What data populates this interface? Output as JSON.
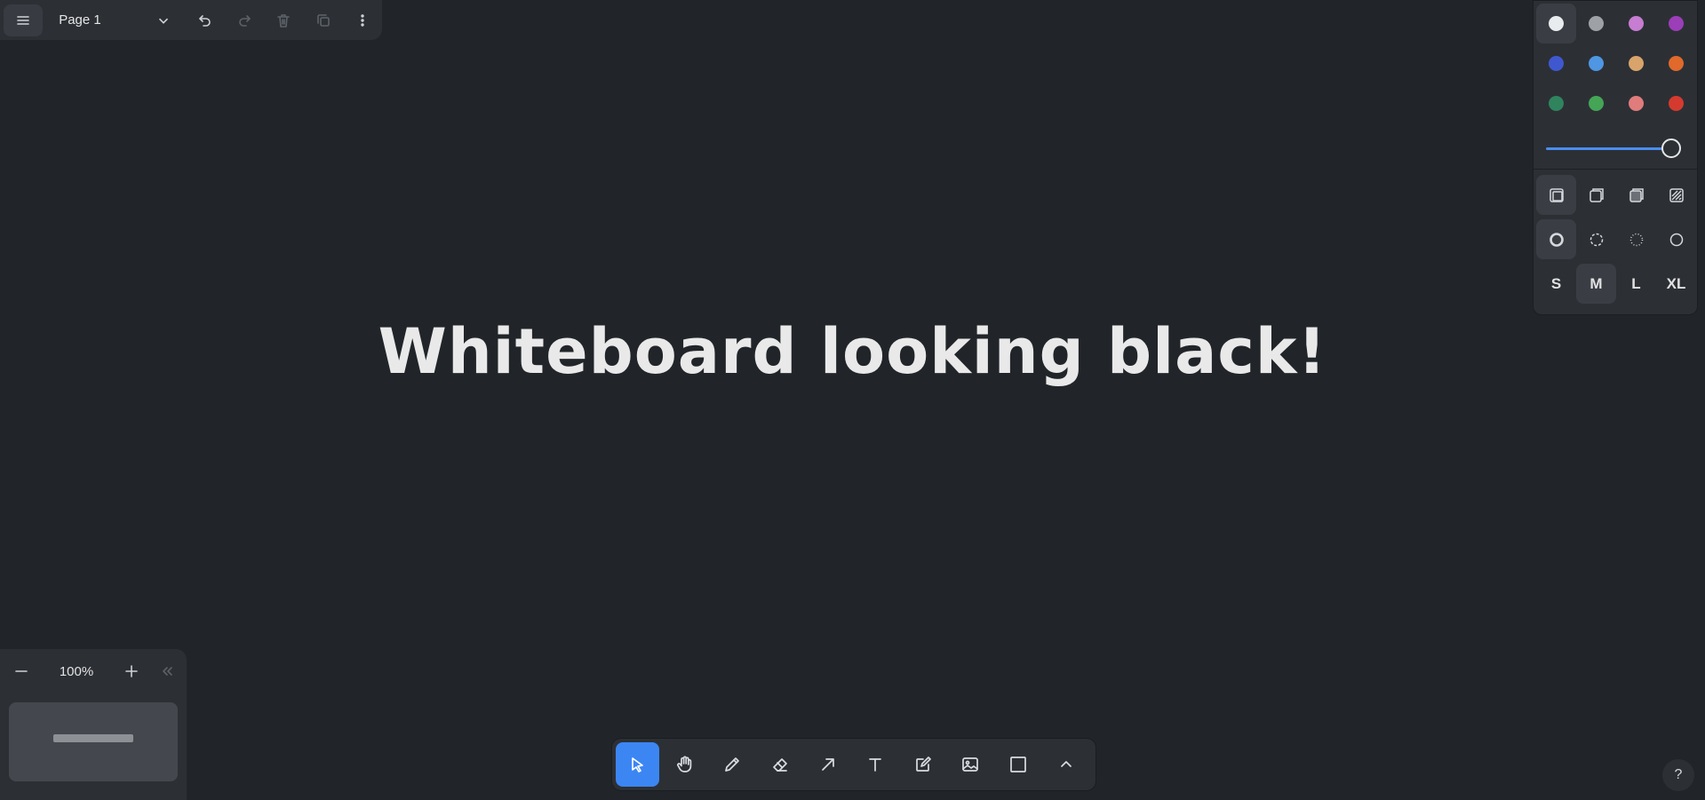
{
  "menu": {
    "page_name": "Page 1",
    "icons": [
      "hamburger-icon",
      "chevron-down-icon",
      "undo-icon",
      "redo-icon",
      "trash-icon",
      "duplicate-icon",
      "more-vertical-icon"
    ]
  },
  "canvas": {
    "text": "Whiteboard looking black!"
  },
  "style_panel": {
    "colors": [
      {
        "name": "white",
        "hex": "#e9ecef",
        "selected": true
      },
      {
        "name": "grey",
        "hex": "#9ea2a7"
      },
      {
        "name": "light-violet",
        "hex": "#c77dd1"
      },
      {
        "name": "violet",
        "hex": "#9b3eb8"
      },
      {
        "name": "blue",
        "hex": "#3f58d0"
      },
      {
        "name": "light-blue",
        "hex": "#4f96e3"
      },
      {
        "name": "yellow",
        "hex": "#d8a46b"
      },
      {
        "name": "orange",
        "hex": "#e0692b"
      },
      {
        "name": "green",
        "hex": "#2f845e"
      },
      {
        "name": "light-green",
        "hex": "#45a556"
      },
      {
        "name": "light-red",
        "hex": "#e07c7c"
      },
      {
        "name": "red",
        "hex": "#d53a2f"
      }
    ],
    "opacity_percent": 100,
    "fill_options": [
      "fill-none-icon",
      "fill-semi-icon",
      "fill-solid-icon",
      "fill-pattern-icon"
    ],
    "dash_options": [
      "dash-draw-icon",
      "dash-dashed-icon",
      "dash-dotted-icon",
      "dash-solid-icon"
    ],
    "sizes": [
      "S",
      "M",
      "L",
      "XL"
    ],
    "selected_size": "M"
  },
  "zoom": {
    "level": "100%"
  },
  "toolbar": {
    "tools": [
      "select-icon",
      "hand-icon",
      "draw-icon",
      "eraser-icon",
      "arrow-icon",
      "text-icon",
      "note-icon",
      "image-icon",
      "rectangle-icon",
      "chevron-up-icon"
    ],
    "active_tool": "select",
    "accent": "#3c86f4"
  },
  "help": {
    "label": "?"
  }
}
